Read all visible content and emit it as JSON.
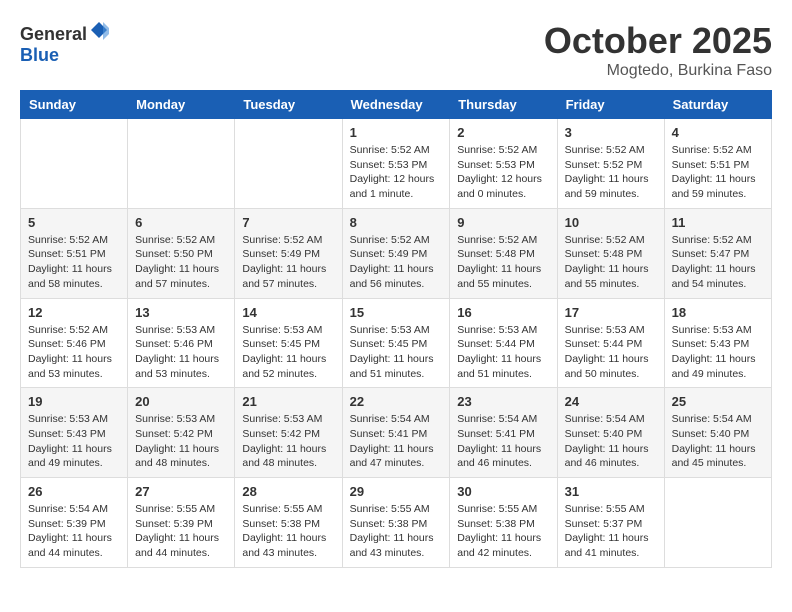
{
  "header": {
    "logo_general": "General",
    "logo_blue": "Blue",
    "month": "October 2025",
    "location": "Mogtedo, Burkina Faso"
  },
  "weekdays": [
    "Sunday",
    "Monday",
    "Tuesday",
    "Wednesday",
    "Thursday",
    "Friday",
    "Saturday"
  ],
  "weeks": [
    [
      {
        "day": "",
        "sunrise": "",
        "sunset": "",
        "daylight": ""
      },
      {
        "day": "",
        "sunrise": "",
        "sunset": "",
        "daylight": ""
      },
      {
        "day": "",
        "sunrise": "",
        "sunset": "",
        "daylight": ""
      },
      {
        "day": "1",
        "sunrise": "Sunrise: 5:52 AM",
        "sunset": "Sunset: 5:53 PM",
        "daylight": "Daylight: 12 hours and 1 minute."
      },
      {
        "day": "2",
        "sunrise": "Sunrise: 5:52 AM",
        "sunset": "Sunset: 5:53 PM",
        "daylight": "Daylight: 12 hours and 0 minutes."
      },
      {
        "day": "3",
        "sunrise": "Sunrise: 5:52 AM",
        "sunset": "Sunset: 5:52 PM",
        "daylight": "Daylight: 11 hours and 59 minutes."
      },
      {
        "day": "4",
        "sunrise": "Sunrise: 5:52 AM",
        "sunset": "Sunset: 5:51 PM",
        "daylight": "Daylight: 11 hours and 59 minutes."
      }
    ],
    [
      {
        "day": "5",
        "sunrise": "Sunrise: 5:52 AM",
        "sunset": "Sunset: 5:51 PM",
        "daylight": "Daylight: 11 hours and 58 minutes."
      },
      {
        "day": "6",
        "sunrise": "Sunrise: 5:52 AM",
        "sunset": "Sunset: 5:50 PM",
        "daylight": "Daylight: 11 hours and 57 minutes."
      },
      {
        "day": "7",
        "sunrise": "Sunrise: 5:52 AM",
        "sunset": "Sunset: 5:49 PM",
        "daylight": "Daylight: 11 hours and 57 minutes."
      },
      {
        "day": "8",
        "sunrise": "Sunrise: 5:52 AM",
        "sunset": "Sunset: 5:49 PM",
        "daylight": "Daylight: 11 hours and 56 minutes."
      },
      {
        "day": "9",
        "sunrise": "Sunrise: 5:52 AM",
        "sunset": "Sunset: 5:48 PM",
        "daylight": "Daylight: 11 hours and 55 minutes."
      },
      {
        "day": "10",
        "sunrise": "Sunrise: 5:52 AM",
        "sunset": "Sunset: 5:48 PM",
        "daylight": "Daylight: 11 hours and 55 minutes."
      },
      {
        "day": "11",
        "sunrise": "Sunrise: 5:52 AM",
        "sunset": "Sunset: 5:47 PM",
        "daylight": "Daylight: 11 hours and 54 minutes."
      }
    ],
    [
      {
        "day": "12",
        "sunrise": "Sunrise: 5:52 AM",
        "sunset": "Sunset: 5:46 PM",
        "daylight": "Daylight: 11 hours and 53 minutes."
      },
      {
        "day": "13",
        "sunrise": "Sunrise: 5:53 AM",
        "sunset": "Sunset: 5:46 PM",
        "daylight": "Daylight: 11 hours and 53 minutes."
      },
      {
        "day": "14",
        "sunrise": "Sunrise: 5:53 AM",
        "sunset": "Sunset: 5:45 PM",
        "daylight": "Daylight: 11 hours and 52 minutes."
      },
      {
        "day": "15",
        "sunrise": "Sunrise: 5:53 AM",
        "sunset": "Sunset: 5:45 PM",
        "daylight": "Daylight: 11 hours and 51 minutes."
      },
      {
        "day": "16",
        "sunrise": "Sunrise: 5:53 AM",
        "sunset": "Sunset: 5:44 PM",
        "daylight": "Daylight: 11 hours and 51 minutes."
      },
      {
        "day": "17",
        "sunrise": "Sunrise: 5:53 AM",
        "sunset": "Sunset: 5:44 PM",
        "daylight": "Daylight: 11 hours and 50 minutes."
      },
      {
        "day": "18",
        "sunrise": "Sunrise: 5:53 AM",
        "sunset": "Sunset: 5:43 PM",
        "daylight": "Daylight: 11 hours and 49 minutes."
      }
    ],
    [
      {
        "day": "19",
        "sunrise": "Sunrise: 5:53 AM",
        "sunset": "Sunset: 5:43 PM",
        "daylight": "Daylight: 11 hours and 49 minutes."
      },
      {
        "day": "20",
        "sunrise": "Sunrise: 5:53 AM",
        "sunset": "Sunset: 5:42 PM",
        "daylight": "Daylight: 11 hours and 48 minutes."
      },
      {
        "day": "21",
        "sunrise": "Sunrise: 5:53 AM",
        "sunset": "Sunset: 5:42 PM",
        "daylight": "Daylight: 11 hours and 48 minutes."
      },
      {
        "day": "22",
        "sunrise": "Sunrise: 5:54 AM",
        "sunset": "Sunset: 5:41 PM",
        "daylight": "Daylight: 11 hours and 47 minutes."
      },
      {
        "day": "23",
        "sunrise": "Sunrise: 5:54 AM",
        "sunset": "Sunset: 5:41 PM",
        "daylight": "Daylight: 11 hours and 46 minutes."
      },
      {
        "day": "24",
        "sunrise": "Sunrise: 5:54 AM",
        "sunset": "Sunset: 5:40 PM",
        "daylight": "Daylight: 11 hours and 46 minutes."
      },
      {
        "day": "25",
        "sunrise": "Sunrise: 5:54 AM",
        "sunset": "Sunset: 5:40 PM",
        "daylight": "Daylight: 11 hours and 45 minutes."
      }
    ],
    [
      {
        "day": "26",
        "sunrise": "Sunrise: 5:54 AM",
        "sunset": "Sunset: 5:39 PM",
        "daylight": "Daylight: 11 hours and 44 minutes."
      },
      {
        "day": "27",
        "sunrise": "Sunrise: 5:55 AM",
        "sunset": "Sunset: 5:39 PM",
        "daylight": "Daylight: 11 hours and 44 minutes."
      },
      {
        "day": "28",
        "sunrise": "Sunrise: 5:55 AM",
        "sunset": "Sunset: 5:38 PM",
        "daylight": "Daylight: 11 hours and 43 minutes."
      },
      {
        "day": "29",
        "sunrise": "Sunrise: 5:55 AM",
        "sunset": "Sunset: 5:38 PM",
        "daylight": "Daylight: 11 hours and 43 minutes."
      },
      {
        "day": "30",
        "sunrise": "Sunrise: 5:55 AM",
        "sunset": "Sunset: 5:38 PM",
        "daylight": "Daylight: 11 hours and 42 minutes."
      },
      {
        "day": "31",
        "sunrise": "Sunrise: 5:55 AM",
        "sunset": "Sunset: 5:37 PM",
        "daylight": "Daylight: 11 hours and 41 minutes."
      },
      {
        "day": "",
        "sunrise": "",
        "sunset": "",
        "daylight": ""
      }
    ]
  ]
}
